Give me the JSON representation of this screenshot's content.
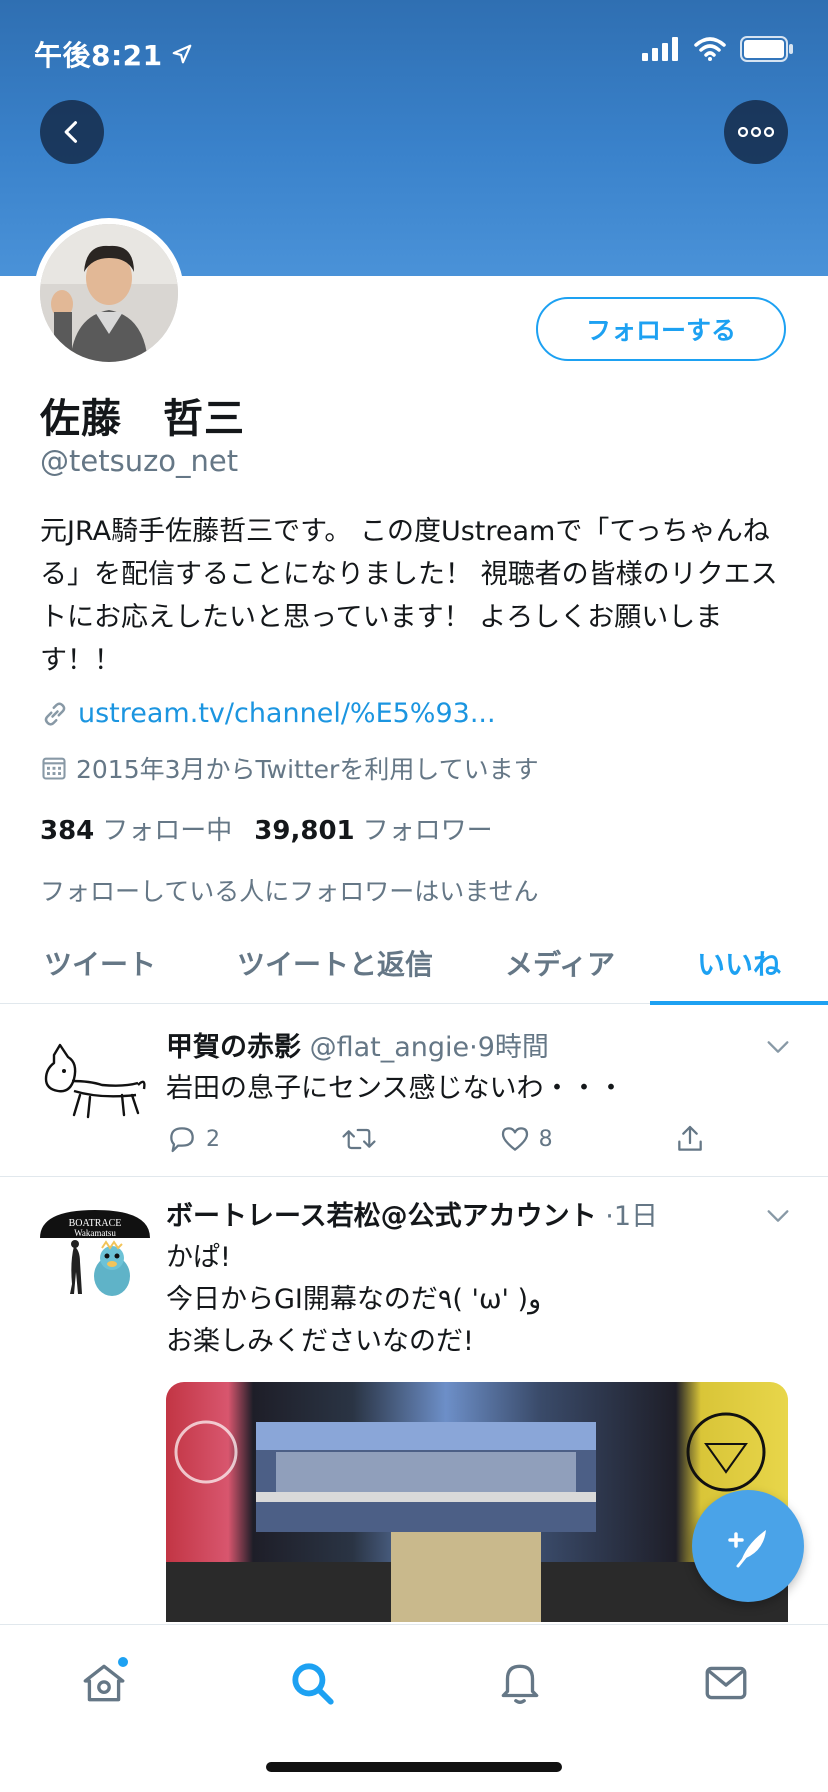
{
  "status_bar": {
    "time": "午後8:21"
  },
  "profile": {
    "display_name": "佐藤　哲三",
    "handle": "@tetsuzo_net",
    "bio": "元JRA騎手佐藤哲三です。 この度Ustreamで「てっちゃんねる」を配信することになりました！ 視聴者の皆様のリクエストにお応えしたいと思っています！ よろしくお願いします！！",
    "link": "ustream.tv/channel/%E5%93...",
    "joined": "2015年3月からTwitterを利用しています",
    "following_count": "384",
    "following_label": "フォロー中",
    "followers_count": "39,801",
    "followers_label": "フォロワー",
    "followers_note": "フォローしている人にフォロワーはいません",
    "follow_button": "フォローする"
  },
  "tabs": [
    {
      "label": "ツイート",
      "active": false
    },
    {
      "label": "ツイートと返信",
      "active": false
    },
    {
      "label": "メディア",
      "active": false
    },
    {
      "label": "いいね",
      "active": true
    }
  ],
  "tweets": [
    {
      "display_name": "甲賀の赤影",
      "handle": "@flat_angie",
      "time": "9時間",
      "text": "岩田の息子にセンス感じないわ・・・",
      "replies": "2",
      "likes": "8"
    },
    {
      "display_name": "ボートレース若松@公式アカウント",
      "time": "1日",
      "text_lines": [
        "かぱ!",
        "今日からGI開幕なのだ٩( 'ω' )و",
        "お楽しみくださいなのだ!"
      ],
      "avatar_text": [
        "BOATRACE",
        "Wakamatsu"
      ]
    }
  ],
  "colors": {
    "accent": "#1da1f2",
    "secondary_text": "#657786",
    "banner": "#3a82cb"
  }
}
